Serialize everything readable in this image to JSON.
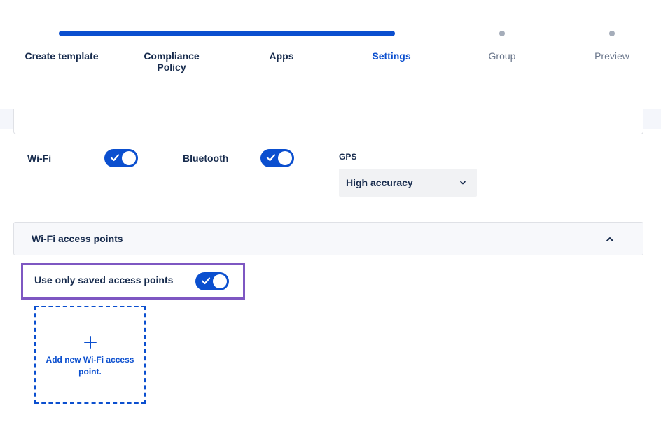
{
  "stepper": {
    "steps": [
      {
        "label": "Create template",
        "state": "complete"
      },
      {
        "label": "Compliance Policy",
        "state": "complete"
      },
      {
        "label": "Apps",
        "state": "complete"
      },
      {
        "label": "Settings",
        "state": "current"
      },
      {
        "label": "Group",
        "state": "upcoming"
      },
      {
        "label": "Preview",
        "state": "upcoming"
      }
    ]
  },
  "settings": {
    "wifi": {
      "label": "Wi-Fi",
      "enabled": true
    },
    "bluetooth": {
      "label": "Bluetooth",
      "enabled": true
    },
    "gps": {
      "label": "GPS",
      "value": "High accuracy"
    }
  },
  "wifi_access_points": {
    "title": "Wi-Fi access points",
    "expanded": true,
    "use_saved": {
      "label": "Use only saved access points",
      "enabled": true
    },
    "add_card": {
      "text": "Add new Wi-Fi access point."
    }
  },
  "colors": {
    "accent": "#0b4fcf",
    "highlight": "#7e57c2",
    "text": "#172b4d",
    "muted": "#6b778c"
  },
  "icons": {
    "toggle_check": "check-icon",
    "select_chevron": "chevron-down-icon",
    "accordion_chevron": "chevron-up-icon",
    "add": "plus-icon"
  }
}
